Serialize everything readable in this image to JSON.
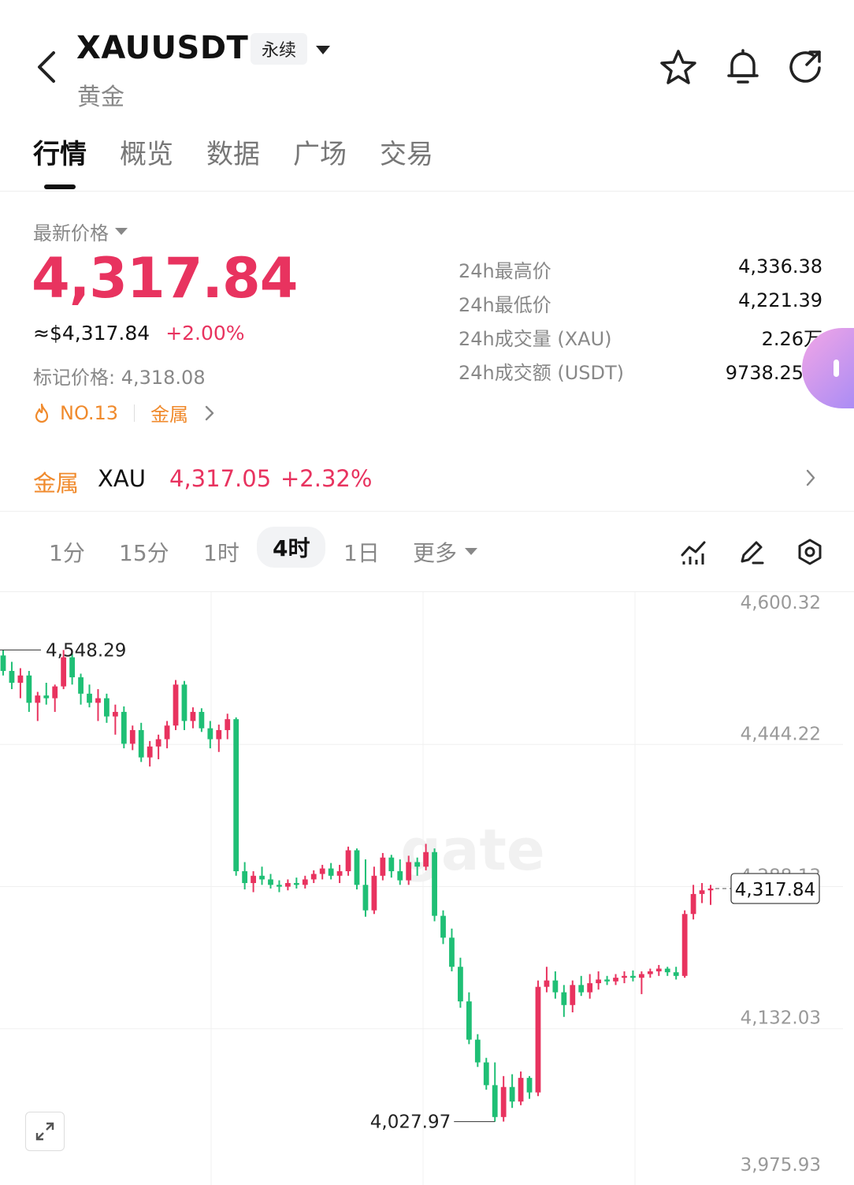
{
  "header": {
    "title": "XAUUSDT",
    "subtitle": "黄金",
    "perp_label": "永续"
  },
  "tabs": [
    "行情",
    "概览",
    "数据",
    "广场",
    "交易"
  ],
  "price": {
    "latest_label": "最新价格",
    "last": "4,317.84",
    "usd_equiv": "≈$4,317.84",
    "change": "+2.00%",
    "mark_price": "标记价格: 4,318.08",
    "rank": "NO.13",
    "category": "金属"
  },
  "stats": [
    {
      "label": "24h最高价",
      "value": "4,336.38"
    },
    {
      "label": "24h最低价",
      "value": "4,221.39"
    },
    {
      "label": "24h成交量 (XAU)",
      "value": "2.26万"
    },
    {
      "label": "24h成交额 (USDT)",
      "value": "9738.25万"
    }
  ],
  "metal_index": {
    "category": "金属",
    "symbol": "XAU",
    "price": "4,317.05",
    "change": "+2.32%"
  },
  "intervals": {
    "items": [
      "1分",
      "15分",
      "1时",
      "4时",
      "1日"
    ],
    "active": "4时",
    "more": "更多"
  },
  "colors": {
    "up": "#e8335f",
    "down": "#1fbf75",
    "accent_orange": "#f08a2c",
    "grey": "#888888"
  },
  "chart_data": {
    "type": "candlestick",
    "y_ticks": [
      "4,600.32",
      "4,444.22",
      "4,288.13",
      "4,132.03",
      "3,975.93"
    ],
    "y_tick_values": [
      4600.32,
      4444.22,
      4288.13,
      4132.03,
      3975.93
    ],
    "ylim": [
      3975.93,
      4600.32
    ],
    "high_label": "4,548.29",
    "low_label": "4,027.97",
    "last_price_label": "4,317.84",
    "ohlc": [
      [
        4542,
        4548,
        4520,
        4525
      ],
      [
        4525,
        4535,
        4505,
        4512
      ],
      [
        4512,
        4528,
        4495,
        4520
      ],
      [
        4520,
        4525,
        4480,
        4490
      ],
      [
        4490,
        4502,
        4470,
        4498
      ],
      [
        4498,
        4512,
        4488,
        4495
      ],
      [
        4495,
        4510,
        4480,
        4508
      ],
      [
        4508,
        4548,
        4505,
        4540
      ],
      [
        4540,
        4544,
        4510,
        4518
      ],
      [
        4518,
        4522,
        4488,
        4500
      ],
      [
        4500,
        4510,
        4485,
        4490
      ],
      [
        4490,
        4505,
        4470,
        4495
      ],
      [
        4495,
        4500,
        4468,
        4475
      ],
      [
        4475,
        4488,
        4455,
        4480
      ],
      [
        4480,
        4486,
        4440,
        4445
      ],
      [
        4445,
        4465,
        4438,
        4460
      ],
      [
        4460,
        4468,
        4425,
        4430
      ],
      [
        4430,
        4448,
        4420,
        4442
      ],
      [
        4442,
        4455,
        4428,
        4450
      ],
      [
        4450,
        4470,
        4440,
        4465
      ],
      [
        4465,
        4515,
        4460,
        4510
      ],
      [
        4510,
        4514,
        4460,
        4470
      ],
      [
        4470,
        4485,
        4462,
        4480
      ],
      [
        4480,
        4484,
        4458,
        4462
      ],
      [
        4462,
        4470,
        4440,
        4450
      ],
      [
        4450,
        4466,
        4436,
        4460
      ],
      [
        4460,
        4478,
        4450,
        4472
      ],
      [
        4472,
        4474,
        4300,
        4305
      ],
      [
        4305,
        4315,
        4285,
        4292
      ],
      [
        4292,
        4305,
        4282,
        4300
      ],
      [
        4300,
        4310,
        4290,
        4296
      ],
      [
        4296,
        4302,
        4286,
        4290
      ],
      [
        4290,
        4295,
        4282,
        4288
      ],
      [
        4288,
        4296,
        4284,
        4292
      ],
      [
        4292,
        4298,
        4286,
        4290
      ],
      [
        4290,
        4300,
        4286,
        4296
      ],
      [
        4296,
        4306,
        4292,
        4302
      ],
      [
        4302,
        4312,
        4296,
        4308
      ],
      [
        4308,
        4314,
        4296,
        4300
      ],
      [
        4300,
        4312,
        4292,
        4305
      ],
      [
        4305,
        4332,
        4300,
        4328
      ],
      [
        4328,
        4330,
        4285,
        4290
      ],
      [
        4290,
        4318,
        4255,
        4262
      ],
      [
        4262,
        4310,
        4258,
        4300
      ],
      [
        4300,
        4325,
        4295,
        4320
      ],
      [
        4320,
        4323,
        4298,
        4305
      ],
      [
        4305,
        4318,
        4290,
        4295
      ],
      [
        4295,
        4322,
        4290,
        4315
      ],
      [
        4315,
        4320,
        4300,
        4310
      ],
      [
        4310,
        4335,
        4306,
        4326
      ],
      [
        4326,
        4330,
        4250,
        4256
      ],
      [
        4256,
        4262,
        4225,
        4232
      ],
      [
        4232,
        4242,
        4195,
        4200
      ],
      [
        4200,
        4210,
        4155,
        4162
      ],
      [
        4162,
        4172,
        4115,
        4120
      ],
      [
        4120,
        4126,
        4090,
        4095
      ],
      [
        4095,
        4100,
        4065,
        4070
      ],
      [
        4070,
        4095,
        4030,
        4035
      ],
      [
        4035,
        4080,
        4030,
        4068
      ],
      [
        4068,
        4082,
        4045,
        4052
      ],
      [
        4052,
        4085,
        4048,
        4078
      ],
      [
        4078,
        4080,
        4055,
        4062
      ],
      [
        4062,
        4185,
        4058,
        4178
      ],
      [
        4178,
        4200,
        4172,
        4185
      ],
      [
        4185,
        4195,
        4165,
        4172
      ],
      [
        4172,
        4180,
        4145,
        4158
      ],
      [
        4158,
        4185,
        4150,
        4180
      ],
      [
        4180,
        4190,
        4168,
        4172
      ],
      [
        4172,
        4192,
        4165,
        4182
      ],
      [
        4182,
        4195,
        4175,
        4186
      ],
      [
        4186,
        4190,
        4180,
        4184
      ],
      [
        4184,
        4192,
        4180,
        4188
      ],
      [
        4188,
        4195,
        4182,
        4190
      ],
      [
        4190,
        4196,
        4184,
        4188
      ],
      [
        4188,
        4195,
        4170,
        4192
      ],
      [
        4192,
        4198,
        4188,
        4195
      ],
      [
        4195,
        4202,
        4190,
        4198
      ],
      [
        4198,
        4200,
        4190,
        4194
      ],
      [
        4194,
        4200,
        4186,
        4190
      ],
      [
        4190,
        4262,
        4188,
        4258
      ],
      [
        4258,
        4290,
        4252,
        4280
      ],
      [
        4280,
        4292,
        4270,
        4284
      ],
      [
        4284,
        4290,
        4268,
        4286
      ]
    ]
  }
}
